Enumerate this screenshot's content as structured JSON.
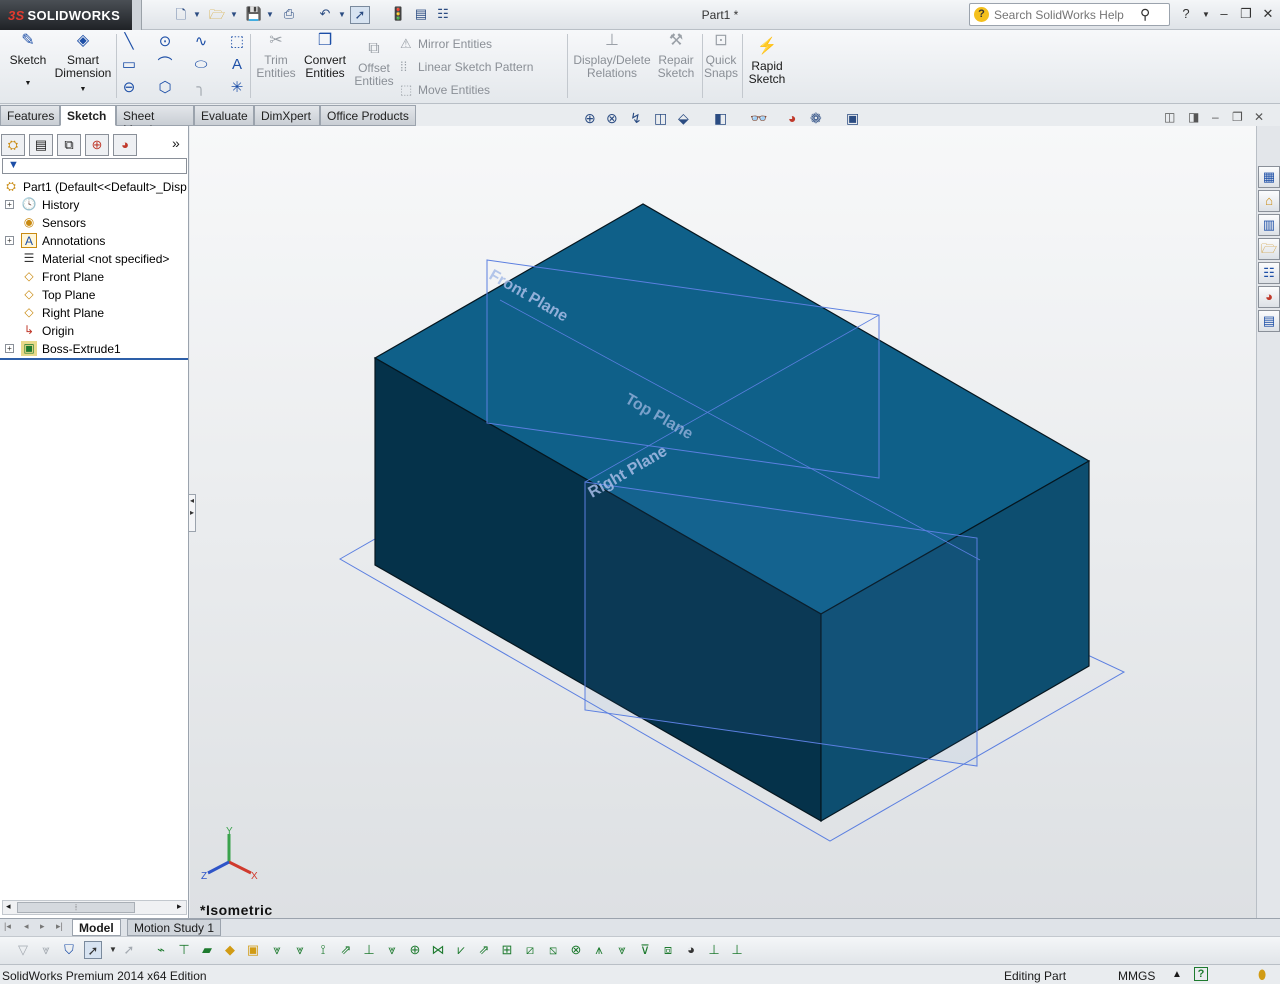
{
  "app": {
    "brand": "SOLIDWORKS",
    "brand_prefix": "3S",
    "document_title": "Part1 *",
    "search_placeholder": "Search SolidWorks Help"
  },
  "command_manager": {
    "sketch": "Sketch",
    "smart_dimension_1": "Smart",
    "smart_dimension_2": "Dimension",
    "trim_1": "Trim",
    "trim_2": "Entities",
    "convert_1": "Convert",
    "convert_2": "Entities",
    "offset_1": "Offset",
    "offset_2": "Entities",
    "mirror": "Mirror Entities",
    "linear_pattern": "Linear Sketch Pattern",
    "move": "Move Entities",
    "display_delete_1": "Display/Delete",
    "display_delete_2": "Relations",
    "repair_1": "Repair",
    "repair_2": "Sketch",
    "quick_snaps_1": "Quick",
    "quick_snaps_2": "Snaps",
    "rapid_1": "Rapid",
    "rapid_2": "Sketch"
  },
  "tabs": [
    "Features",
    "Sketch",
    "Sheet Metal",
    "Evaluate",
    "DimXpert",
    "Office Products"
  ],
  "active_tab": "Sketch",
  "feature_tree": {
    "root": "Part1  (Default<<Default>_Disp",
    "items": [
      {
        "label": "History",
        "icon": "history-icon",
        "expandable": true
      },
      {
        "label": "Sensors",
        "icon": "sensors-icon",
        "expandable": false
      },
      {
        "label": "Annotations",
        "icon": "annotations-icon",
        "expandable": true
      },
      {
        "label": "Material <not specified>",
        "icon": "material-icon",
        "expandable": false
      },
      {
        "label": "Front Plane",
        "icon": "plane-icon",
        "expandable": false
      },
      {
        "label": "Top Plane",
        "icon": "plane-icon",
        "expandable": false
      },
      {
        "label": "Right Plane",
        "icon": "plane-icon",
        "expandable": false
      },
      {
        "label": "Origin",
        "icon": "origin-icon",
        "expandable": false
      },
      {
        "label": "Boss-Extrude1",
        "icon": "extrude-icon",
        "expandable": true
      }
    ]
  },
  "viewport": {
    "plane_labels": [
      "Front Plane",
      "Top Plane",
      "Right Plane"
    ],
    "view_orientation": "*Isometric",
    "triad_axes": [
      "Y",
      "Z",
      "X"
    ],
    "model_color": "#0f5f85"
  },
  "bottom_tabs": [
    "Model",
    "Motion Study 1"
  ],
  "active_bottom_tab": "Model",
  "status": {
    "edition": "SolidWorks Premium 2014 x64 Edition",
    "mode": "Editing Part",
    "units": "MMGS"
  }
}
